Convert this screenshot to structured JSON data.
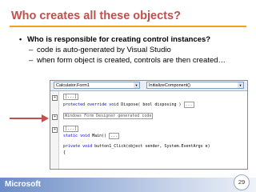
{
  "slide": {
    "title": "Who creates all these objects?",
    "bullet": "Who is responsible for creating control instances?",
    "sub_bullets": [
      "code is auto-generated by Visual Studio",
      "when form object is created, controls are then created…"
    ],
    "footer_brand": "Microsoft",
    "page_number": "29"
  },
  "editor": {
    "class_combo": "Calculator.Form1",
    "member_combo": "InitializeComponent()",
    "lines": [
      {
        "fold": "+",
        "text": "[...]"
      },
      {
        "fold": "",
        "kw": "protected override void",
        "text": " Dispose( bool disposing )",
        "box": "..."
      },
      {
        "fold": "+",
        "text": "Windows Form Designer generated code"
      },
      {
        "fold": "+",
        "text": "[...]"
      },
      {
        "fold": "",
        "kw": "static void",
        "text": " Main()",
        "box": "..."
      },
      {
        "fold": "",
        "kw": "private void",
        "text": " button1_Click(object sender, System.EventArgs e)"
      },
      {
        "fold": "",
        "text": "{"
      }
    ]
  },
  "colors": {
    "title": "#c0504d",
    "title_rule": "#f8a020",
    "arrow": "#c0504d",
    "keyword": "#0000ff"
  },
  "icons": [
    "dropdown-arrow-icon",
    "fold-toggle-icon",
    "pointer-arrow"
  ]
}
